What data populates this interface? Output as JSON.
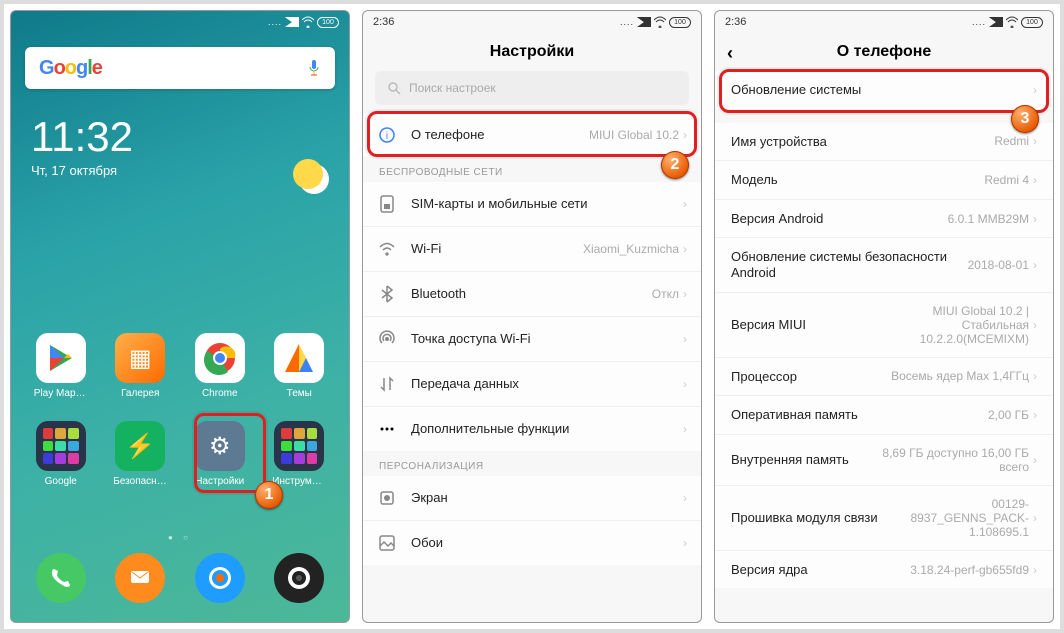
{
  "phone1": {
    "clock_time": "11:32",
    "clock_date": "Чт, 17 октября",
    "search_logo": "Google",
    "apps_r1": [
      {
        "label": "Play Маркет",
        "color": "#fff",
        "svg": "play"
      },
      {
        "label": "Галерея",
        "color": "linear-gradient(135deg,#ffb04a,#ff6a00)",
        "glyph": "▦"
      },
      {
        "label": "Chrome",
        "color": "#fff",
        "svg": "chrome"
      },
      {
        "label": "Темы",
        "color": "#fff",
        "svg": "themes"
      }
    ],
    "apps_r2": [
      {
        "label": "Google",
        "color": "#2a3448",
        "glyph": ""
      },
      {
        "label": "Безопасность",
        "color": "#13b160",
        "glyph": "⚡"
      },
      {
        "label": "Настройки",
        "color": "#5d7a92",
        "glyph": "⚙"
      },
      {
        "label": "Инструменты",
        "color": "#2a3448",
        "glyph": ""
      }
    ],
    "dock": [
      {
        "color": "#46c864",
        "glyph": "phone"
      },
      {
        "color": "#ff8a1e",
        "glyph": "msg"
      },
      {
        "color": "#1e9cff",
        "glyph": "browser"
      },
      {
        "color": "#222",
        "glyph": "cam"
      }
    ]
  },
  "phone2": {
    "time": "2:36",
    "title": "Настройки",
    "search_placeholder": "Поиск настроек",
    "about": {
      "label": "О телефоне",
      "value": "MIUI Global 10.2"
    },
    "section_wireless": "БЕСПРОВОДНЫЕ СЕТИ",
    "rows_wireless": [
      {
        "icon": "sim",
        "label": "SIM-карты и мобильные сети",
        "value": ""
      },
      {
        "icon": "wifi",
        "label": "Wi-Fi",
        "value": "Xiaomi_Kuzmicha"
      },
      {
        "icon": "bt",
        "label": "Bluetooth",
        "value": "Откл"
      },
      {
        "icon": "hotspot",
        "label": "Точка доступа Wi-Fi",
        "value": ""
      },
      {
        "icon": "data",
        "label": "Передача данных",
        "value": ""
      },
      {
        "icon": "more",
        "label": "Дополнительные функции",
        "value": ""
      }
    ],
    "section_personal": "ПЕРСОНАЛИЗАЦИЯ",
    "rows_personal": [
      {
        "icon": "screen",
        "label": "Экран",
        "value": ""
      },
      {
        "icon": "wall",
        "label": "Обои",
        "value": ""
      }
    ]
  },
  "phone3": {
    "time": "2:36",
    "title": "О телефоне",
    "update_label": "Обновление системы",
    "rows": [
      {
        "label": "Имя устройства",
        "value": "Redmi"
      },
      {
        "label": "Модель",
        "value": "Redmi 4"
      },
      {
        "label": "Версия Android",
        "value": "6.0.1 MMB29M"
      },
      {
        "label": "Обновление системы безопасности Android",
        "value": "2018-08-01"
      },
      {
        "label": "Версия MIUI",
        "value": "MIUI Global 10.2 | Стабильная 10.2.2.0(MCEMIXM)"
      },
      {
        "label": "Процессор",
        "value": "Восемь ядер Max 1,4ГГц"
      },
      {
        "label": "Оперативная память",
        "value": "2,00 ГБ"
      },
      {
        "label": "Внутренняя память",
        "value": "8,69 ГБ доступно 16,00 ГБ всего"
      },
      {
        "label": "Прошивка модуля связи",
        "value": "00129-8937_GENNS_PACK-1.108695.1"
      },
      {
        "label": "Версия ядра",
        "value": "3.18.24-perf-gb655fd9"
      }
    ]
  },
  "badges": {
    "b1": "1",
    "b2": "2",
    "b3": "3"
  },
  "battery": "100"
}
